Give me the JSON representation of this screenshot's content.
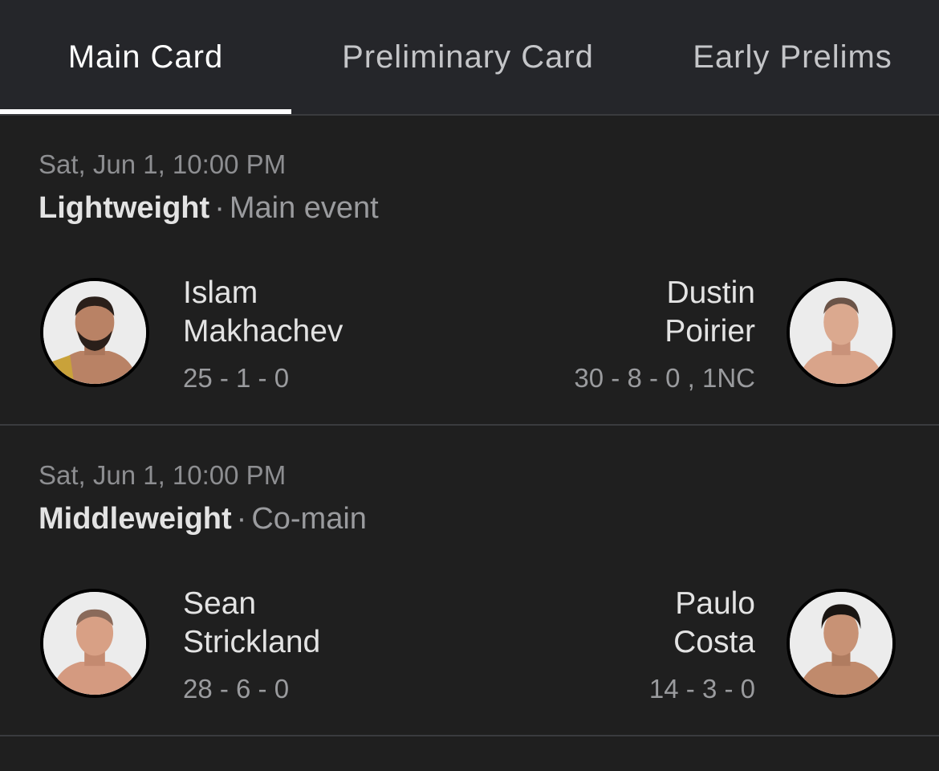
{
  "tabs": [
    {
      "label": "Main Card",
      "active": true
    },
    {
      "label": "Preliminary Card",
      "active": false
    },
    {
      "label": "Early Prelims",
      "active": false
    }
  ],
  "fights": [
    {
      "datetime": "Sat, Jun 1, 10:00 PM",
      "division": "Lightweight",
      "separator": "·",
      "slot": "Main event",
      "fighter_left": {
        "first_name": "Islam",
        "last_name": "Makhachev",
        "record": "25 - 1 - 0",
        "avatar_icon": "fighter-headshot-icon"
      },
      "fighter_right": {
        "first_name": "Dustin",
        "last_name": "Poirier",
        "record": "30 - 8 - 0 , 1NC",
        "avatar_icon": "fighter-headshot-icon"
      }
    },
    {
      "datetime": "Sat, Jun 1, 10:00 PM",
      "division": "Middleweight",
      "separator": "·",
      "slot": "Co-main",
      "fighter_left": {
        "first_name": "Sean",
        "last_name": "Strickland",
        "record": "28 - 6 - 0",
        "avatar_icon": "fighter-headshot-icon"
      },
      "fighter_right": {
        "first_name": "Paulo",
        "last_name": "Costa",
        "record": "14 - 3 - 0",
        "avatar_icon": "fighter-headshot-icon"
      }
    }
  ],
  "colors": {
    "background": "#1f1f1f",
    "tabbar": "#25262a",
    "active_tab": "#ffffff",
    "inactive_tab": "#c4c5c8",
    "secondary_text": "#9a9b9e"
  }
}
